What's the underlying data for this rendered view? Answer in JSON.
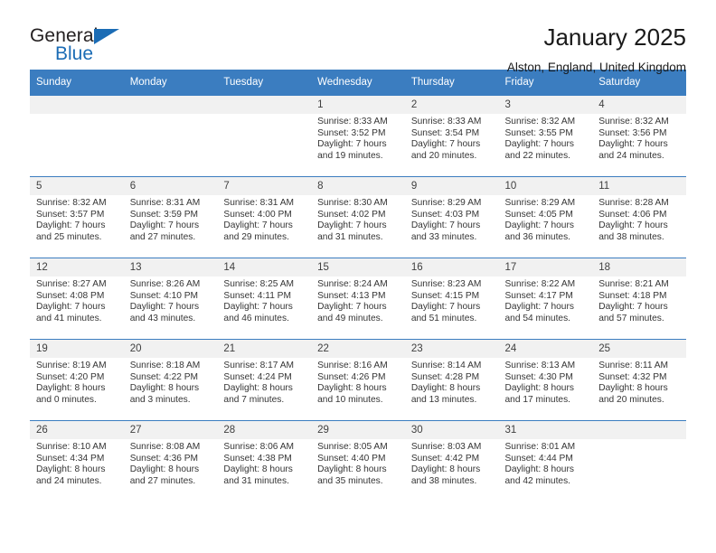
{
  "brand": {
    "name_part1": "General",
    "name_part2": "Blue"
  },
  "header": {
    "month_title": "January 2025",
    "location": "Alston, England, United Kingdom"
  },
  "colors": {
    "header_blue": "#3b7dc0",
    "logo_blue": "#1b6cb5",
    "daynum_band": "#f1f1f1"
  },
  "weekday_headers": [
    "Sunday",
    "Monday",
    "Tuesday",
    "Wednesday",
    "Thursday",
    "Friday",
    "Saturday"
  ],
  "weeks": [
    [
      {
        "day": "",
        "sunrise": "",
        "sunset": "",
        "daylight_line1": "",
        "daylight_line2": ""
      },
      {
        "day": "",
        "sunrise": "",
        "sunset": "",
        "daylight_line1": "",
        "daylight_line2": ""
      },
      {
        "day": "",
        "sunrise": "",
        "sunset": "",
        "daylight_line1": "",
        "daylight_line2": ""
      },
      {
        "day": "1",
        "sunrise": "Sunrise: 8:33 AM",
        "sunset": "Sunset: 3:52 PM",
        "daylight_line1": "Daylight: 7 hours",
        "daylight_line2": "and 19 minutes."
      },
      {
        "day": "2",
        "sunrise": "Sunrise: 8:33 AM",
        "sunset": "Sunset: 3:54 PM",
        "daylight_line1": "Daylight: 7 hours",
        "daylight_line2": "and 20 minutes."
      },
      {
        "day": "3",
        "sunrise": "Sunrise: 8:32 AM",
        "sunset": "Sunset: 3:55 PM",
        "daylight_line1": "Daylight: 7 hours",
        "daylight_line2": "and 22 minutes."
      },
      {
        "day": "4",
        "sunrise": "Sunrise: 8:32 AM",
        "sunset": "Sunset: 3:56 PM",
        "daylight_line1": "Daylight: 7 hours",
        "daylight_line2": "and 24 minutes."
      }
    ],
    [
      {
        "day": "5",
        "sunrise": "Sunrise: 8:32 AM",
        "sunset": "Sunset: 3:57 PM",
        "daylight_line1": "Daylight: 7 hours",
        "daylight_line2": "and 25 minutes."
      },
      {
        "day": "6",
        "sunrise": "Sunrise: 8:31 AM",
        "sunset": "Sunset: 3:59 PM",
        "daylight_line1": "Daylight: 7 hours",
        "daylight_line2": "and 27 minutes."
      },
      {
        "day": "7",
        "sunrise": "Sunrise: 8:31 AM",
        "sunset": "Sunset: 4:00 PM",
        "daylight_line1": "Daylight: 7 hours",
        "daylight_line2": "and 29 minutes."
      },
      {
        "day": "8",
        "sunrise": "Sunrise: 8:30 AM",
        "sunset": "Sunset: 4:02 PM",
        "daylight_line1": "Daylight: 7 hours",
        "daylight_line2": "and 31 minutes."
      },
      {
        "day": "9",
        "sunrise": "Sunrise: 8:29 AM",
        "sunset": "Sunset: 4:03 PM",
        "daylight_line1": "Daylight: 7 hours",
        "daylight_line2": "and 33 minutes."
      },
      {
        "day": "10",
        "sunrise": "Sunrise: 8:29 AM",
        "sunset": "Sunset: 4:05 PM",
        "daylight_line1": "Daylight: 7 hours",
        "daylight_line2": "and 36 minutes."
      },
      {
        "day": "11",
        "sunrise": "Sunrise: 8:28 AM",
        "sunset": "Sunset: 4:06 PM",
        "daylight_line1": "Daylight: 7 hours",
        "daylight_line2": "and 38 minutes."
      }
    ],
    [
      {
        "day": "12",
        "sunrise": "Sunrise: 8:27 AM",
        "sunset": "Sunset: 4:08 PM",
        "daylight_line1": "Daylight: 7 hours",
        "daylight_line2": "and 41 minutes."
      },
      {
        "day": "13",
        "sunrise": "Sunrise: 8:26 AM",
        "sunset": "Sunset: 4:10 PM",
        "daylight_line1": "Daylight: 7 hours",
        "daylight_line2": "and 43 minutes."
      },
      {
        "day": "14",
        "sunrise": "Sunrise: 8:25 AM",
        "sunset": "Sunset: 4:11 PM",
        "daylight_line1": "Daylight: 7 hours",
        "daylight_line2": "and 46 minutes."
      },
      {
        "day": "15",
        "sunrise": "Sunrise: 8:24 AM",
        "sunset": "Sunset: 4:13 PM",
        "daylight_line1": "Daylight: 7 hours",
        "daylight_line2": "and 49 minutes."
      },
      {
        "day": "16",
        "sunrise": "Sunrise: 8:23 AM",
        "sunset": "Sunset: 4:15 PM",
        "daylight_line1": "Daylight: 7 hours",
        "daylight_line2": "and 51 minutes."
      },
      {
        "day": "17",
        "sunrise": "Sunrise: 8:22 AM",
        "sunset": "Sunset: 4:17 PM",
        "daylight_line1": "Daylight: 7 hours",
        "daylight_line2": "and 54 minutes."
      },
      {
        "day": "18",
        "sunrise": "Sunrise: 8:21 AM",
        "sunset": "Sunset: 4:18 PM",
        "daylight_line1": "Daylight: 7 hours",
        "daylight_line2": "and 57 minutes."
      }
    ],
    [
      {
        "day": "19",
        "sunrise": "Sunrise: 8:19 AM",
        "sunset": "Sunset: 4:20 PM",
        "daylight_line1": "Daylight: 8 hours",
        "daylight_line2": "and 0 minutes."
      },
      {
        "day": "20",
        "sunrise": "Sunrise: 8:18 AM",
        "sunset": "Sunset: 4:22 PM",
        "daylight_line1": "Daylight: 8 hours",
        "daylight_line2": "and 3 minutes."
      },
      {
        "day": "21",
        "sunrise": "Sunrise: 8:17 AM",
        "sunset": "Sunset: 4:24 PM",
        "daylight_line1": "Daylight: 8 hours",
        "daylight_line2": "and 7 minutes."
      },
      {
        "day": "22",
        "sunrise": "Sunrise: 8:16 AM",
        "sunset": "Sunset: 4:26 PM",
        "daylight_line1": "Daylight: 8 hours",
        "daylight_line2": "and 10 minutes."
      },
      {
        "day": "23",
        "sunrise": "Sunrise: 8:14 AM",
        "sunset": "Sunset: 4:28 PM",
        "daylight_line1": "Daylight: 8 hours",
        "daylight_line2": "and 13 minutes."
      },
      {
        "day": "24",
        "sunrise": "Sunrise: 8:13 AM",
        "sunset": "Sunset: 4:30 PM",
        "daylight_line1": "Daylight: 8 hours",
        "daylight_line2": "and 17 minutes."
      },
      {
        "day": "25",
        "sunrise": "Sunrise: 8:11 AM",
        "sunset": "Sunset: 4:32 PM",
        "daylight_line1": "Daylight: 8 hours",
        "daylight_line2": "and 20 minutes."
      }
    ],
    [
      {
        "day": "26",
        "sunrise": "Sunrise: 8:10 AM",
        "sunset": "Sunset: 4:34 PM",
        "daylight_line1": "Daylight: 8 hours",
        "daylight_line2": "and 24 minutes."
      },
      {
        "day": "27",
        "sunrise": "Sunrise: 8:08 AM",
        "sunset": "Sunset: 4:36 PM",
        "daylight_line1": "Daylight: 8 hours",
        "daylight_line2": "and 27 minutes."
      },
      {
        "day": "28",
        "sunrise": "Sunrise: 8:06 AM",
        "sunset": "Sunset: 4:38 PM",
        "daylight_line1": "Daylight: 8 hours",
        "daylight_line2": "and 31 minutes."
      },
      {
        "day": "29",
        "sunrise": "Sunrise: 8:05 AM",
        "sunset": "Sunset: 4:40 PM",
        "daylight_line1": "Daylight: 8 hours",
        "daylight_line2": "and 35 minutes."
      },
      {
        "day": "30",
        "sunrise": "Sunrise: 8:03 AM",
        "sunset": "Sunset: 4:42 PM",
        "daylight_line1": "Daylight: 8 hours",
        "daylight_line2": "and 38 minutes."
      },
      {
        "day": "31",
        "sunrise": "Sunrise: 8:01 AM",
        "sunset": "Sunset: 4:44 PM",
        "daylight_line1": "Daylight: 8 hours",
        "daylight_line2": "and 42 minutes."
      },
      {
        "day": "",
        "sunrise": "",
        "sunset": "",
        "daylight_line1": "",
        "daylight_line2": ""
      }
    ]
  ]
}
